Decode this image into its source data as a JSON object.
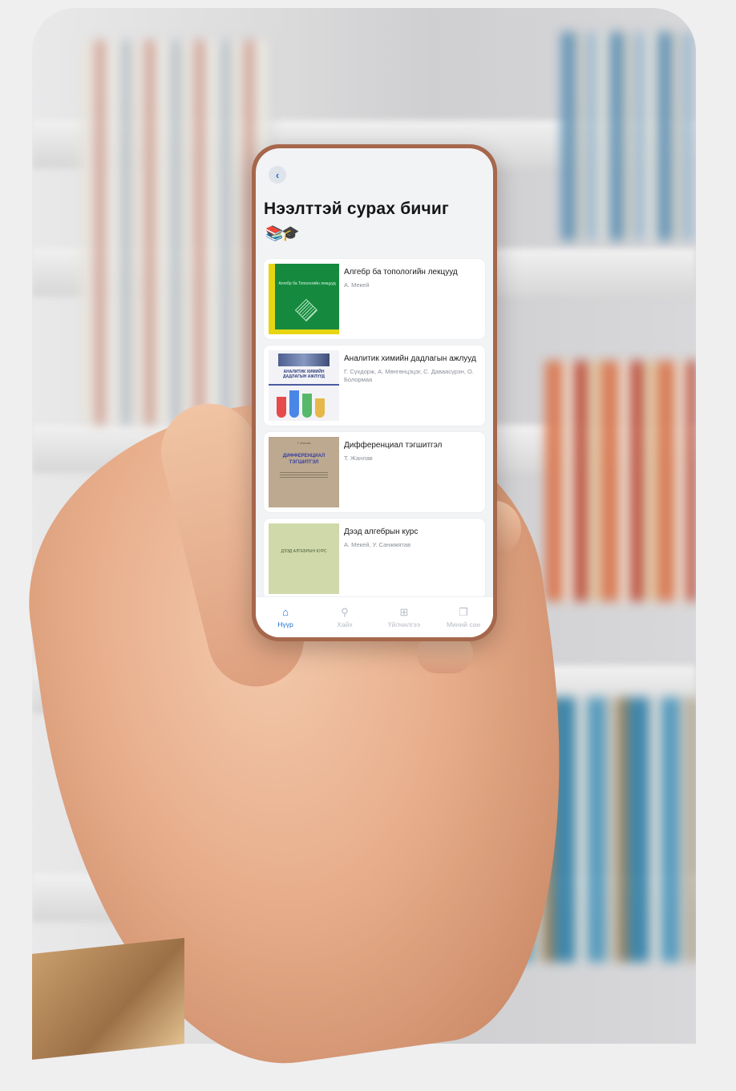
{
  "screen": {
    "title": "Нээлттэй сурах бичиг",
    "title_emoji": "📚🎓",
    "back_icon": "chevron-left-icon"
  },
  "books": [
    {
      "title": "Алгебр ба топологийн лекцууд",
      "author": "А. Мекей",
      "cover_text": "Алгебр ба Топологийн лекцууд"
    },
    {
      "title": "Аналитик химийн дадлагын ажлууд",
      "author": "Г. Сүхдорж, А. Мөнгөнцэцэг, С. Даваасүрэн, О. Болормаа",
      "cover_text": "АНАЛИТИК ХИМИЙН ДАДЛАГЫН АЖЛУУД"
    },
    {
      "title": "Дифференциал тэгшитгэл",
      "author": "Т. Жанлав",
      "cover_text": "ДИФФЕРЕНЦИАЛ ТЭГШИТГЭЛ",
      "cover_small": "Т. Жанлав"
    },
    {
      "title": "Дээд алгебрын курс",
      "author": "А. Мекей, У. Санжмятав",
      "cover_text": "ДЭЭД АЛГЕБРЫН КУРС"
    }
  ],
  "tabs": [
    {
      "label": "Нүүр",
      "icon": "home-icon",
      "active": true
    },
    {
      "label": "Хайх",
      "icon": "search-icon",
      "active": false
    },
    {
      "label": "Үйлчилгээ",
      "icon": "grid-icon",
      "active": false
    },
    {
      "label": "Миний сан",
      "icon": "book-icon",
      "active": false
    }
  ],
  "colors": {
    "accent": "#1e6fd6",
    "phone_frame": "#a6674c",
    "screen_bg": "#f2f3f5"
  }
}
